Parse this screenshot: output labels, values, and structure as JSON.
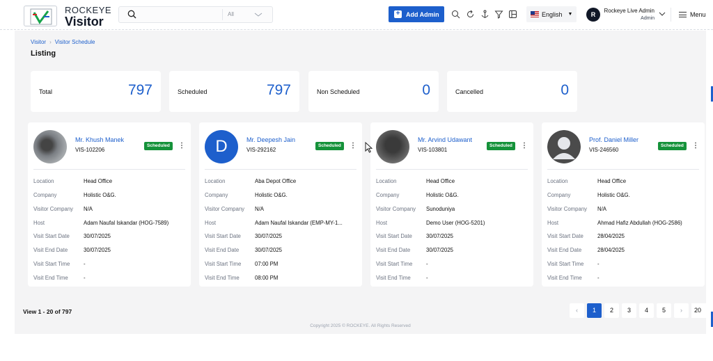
{
  "header": {
    "brand_top": "ROCKEYE",
    "brand_main": "Visitor",
    "search_placeholder": "",
    "search_filter": "All",
    "add_button": "Add Admin",
    "language": "English",
    "user_initial": "R",
    "user_name": "Rockeye Live Admin",
    "user_role": "Admin",
    "menu_label": "Menu"
  },
  "breadcrumb": {
    "items": [
      "Visitor",
      "Visitor Schedule"
    ]
  },
  "page_title": "Listing",
  "stats": [
    {
      "label": "Total",
      "value": "797"
    },
    {
      "label": "Scheduled",
      "value": "797"
    },
    {
      "label": "Non Scheduled",
      "value": "0"
    },
    {
      "label": "Cancelled",
      "value": "0"
    }
  ],
  "row_labels": {
    "location": "Location",
    "company": "Company",
    "visitor_company": "Visitor Company",
    "host": "Host",
    "visit_start_date": "Visit Start Date",
    "visit_end_date": "Visit End Date",
    "visit_start_time": "Visit Start Time",
    "visit_end_time": "Visit End Time"
  },
  "cards": [
    {
      "name": "Mr. Khush Manek",
      "id": "VIS-102206",
      "status": "Scheduled",
      "avatar": "photo",
      "location": "Head Office",
      "company": "Holistic O&G.",
      "visitor_company": "N/A",
      "host": "Adam Naufal Iskandar (HOG-7589)",
      "visit_start_date": "30/07/2025",
      "visit_end_date": "30/07/2025",
      "visit_start_time": "-",
      "visit_end_time": "-"
    },
    {
      "name": "Mr. Deepesh Jain",
      "id": "VIS-292162",
      "status": "Scheduled",
      "avatar_letter": "D",
      "location": "Aba Depot Office",
      "company": "Holistic O&G.",
      "visitor_company": "N/A",
      "host": "Adam Naufal Iskandar (EMP-MY-1...",
      "visit_start_date": "30/07/2025",
      "visit_end_date": "30/07/2025",
      "visit_start_time": "07:00 PM",
      "visit_end_time": "08:00 PM"
    },
    {
      "name": "Mr. Arvind Udawant",
      "id": "VIS-103801",
      "status": "Scheduled",
      "avatar": "photo",
      "location": "Head Office",
      "company": "Holistic O&G.",
      "visitor_company": "Sunoduniya",
      "host": "Demo User (HOG-5201)",
      "visit_start_date": "30/07/2025",
      "visit_end_date": "30/07/2025",
      "visit_start_time": "-",
      "visit_end_time": "-"
    },
    {
      "name": "Prof. Daniel Miller",
      "id": "VIS-246560",
      "status": "Scheduled",
      "avatar": "generic",
      "location": "Head Office",
      "company": "Holistic O&G.",
      "visitor_company": "N/A",
      "host": "Ahmad Hafiz Abdullah (HOG-2586)",
      "visit_start_date": "28/04/2025",
      "visit_end_date": "28/04/2025",
      "visit_start_time": "-",
      "visit_end_time": "-"
    }
  ],
  "footer": {
    "view_text": "View 1 - 20 of 797",
    "pages": [
      "1",
      "2",
      "3",
      "4",
      "5"
    ],
    "prev": "‹",
    "next": "›",
    "page_size": "20",
    "copyright": "Copyright 2025 © ROCKEYE. All Rights Reserved"
  },
  "colors": {
    "accent": "#1d5fcc",
    "badge": "#15923a",
    "background": "#f4f4f5"
  },
  "icons": [
    "search-icon",
    "chevron-down-icon",
    "plus-icon",
    "refresh-icon",
    "anchor-icon",
    "filter-icon",
    "layout-icon",
    "kebab-icon",
    "hamburger-icon"
  ]
}
